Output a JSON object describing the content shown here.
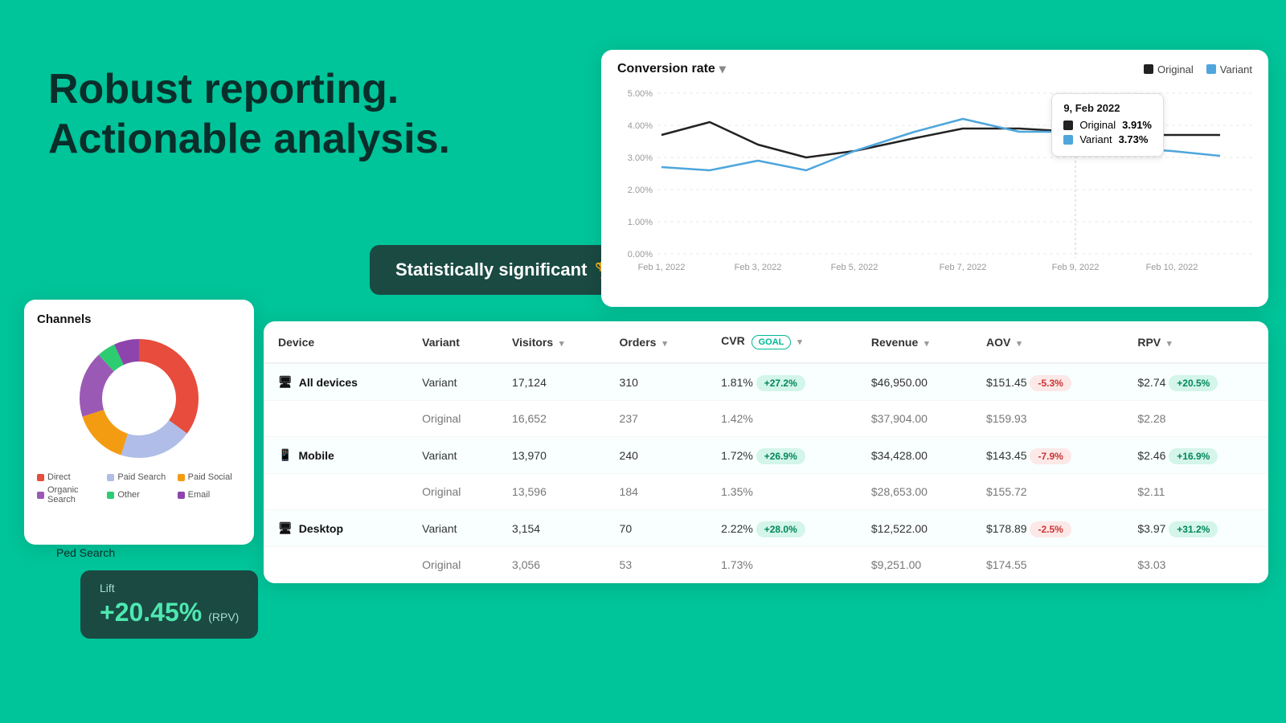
{
  "hero": {
    "line1": "Robust reporting.",
    "line2": "Actionable analysis."
  },
  "stat_sig": {
    "label": "Statistically significant",
    "icon": "🏆"
  },
  "chart": {
    "title": "Conversion rate",
    "dropdown_icon": "▾",
    "legend": [
      {
        "label": "Original",
        "color": "#222"
      },
      {
        "label": "Variant",
        "color": "#4ea6dc"
      }
    ],
    "tooltip": {
      "date": "9, Feb 2022",
      "original_label": "Original",
      "original_value": "3.91%",
      "variant_label": "Variant",
      "variant_value": "3.73%"
    },
    "y_labels": [
      "5.00%",
      "4.00%",
      "3.00%",
      "2.00%",
      "1.00%",
      "0.00%"
    ],
    "x_labels": [
      "Feb 1, 2022",
      "Feb 3, 2022",
      "Feb 5, 2022",
      "Feb 7, 2022",
      "Feb 9, 2022",
      "Feb 10, 2022"
    ]
  },
  "channels": {
    "title": "Channels",
    "legend": [
      {
        "label": "Direct",
        "color": "#e74c3c"
      },
      {
        "label": "Paid Search",
        "color": "#bdc3e8"
      },
      {
        "label": "Paid Social",
        "color": "#f39c12"
      },
      {
        "label": "Organic Search",
        "color": "#9b59b6"
      },
      {
        "label": "Other",
        "color": "#2ecc71"
      },
      {
        "label": "Email",
        "color": "#8e44ad"
      }
    ]
  },
  "lift": {
    "label": "Lift",
    "value": "+20.45%",
    "sub": "(RPV)"
  },
  "ped_search": {
    "label": "Ped Search"
  },
  "table": {
    "columns": [
      "Device",
      "Variant",
      "Visitors",
      "Orders",
      "CVR",
      "Revenue",
      "AOV",
      "RPV"
    ],
    "rows": [
      {
        "device": "All devices",
        "device_icon": "🖥",
        "variant": "Variant",
        "visitors": "17,124",
        "orders": "310",
        "cvr": "1.81%",
        "cvr_badge": "+27.2%",
        "cvr_badge_type": "green",
        "revenue": "$46,950.00",
        "aov": "$151.45",
        "aov_badge": "-5.3%",
        "aov_badge_type": "red",
        "rpv": "$2.74",
        "rpv_badge": "+20.5%",
        "rpv_badge_type": "green",
        "row_type": "variant"
      },
      {
        "device": "",
        "device_icon": "",
        "variant": "Original",
        "visitors": "16,652",
        "orders": "237",
        "cvr": "1.42%",
        "cvr_badge": "",
        "revenue": "$37,904.00",
        "aov": "$159.93",
        "aov_badge": "",
        "rpv": "$2.28",
        "rpv_badge": "",
        "row_type": "original"
      },
      {
        "device": "Mobile",
        "device_icon": "📱",
        "variant": "Variant",
        "visitors": "13,970",
        "orders": "240",
        "cvr": "1.72%",
        "cvr_badge": "+26.9%",
        "cvr_badge_type": "green",
        "revenue": "$34,428.00",
        "aov": "$143.45",
        "aov_badge": "-7.9%",
        "aov_badge_type": "red",
        "rpv": "$2.46",
        "rpv_badge": "+16.9%",
        "rpv_badge_type": "green",
        "row_type": "variant"
      },
      {
        "device": "",
        "device_icon": "",
        "variant": "Original",
        "visitors": "13,596",
        "orders": "184",
        "cvr": "1.35%",
        "cvr_badge": "",
        "revenue": "$28,653.00",
        "aov": "$155.72",
        "aov_badge": "",
        "rpv": "$2.11",
        "rpv_badge": "",
        "row_type": "original"
      },
      {
        "device": "Desktop",
        "device_icon": "🖥",
        "variant": "Variant",
        "visitors": "3,154",
        "orders": "70",
        "cvr": "2.22%",
        "cvr_badge": "+28.0%",
        "cvr_badge_type": "green",
        "revenue": "$12,522.00",
        "aov": "$178.89",
        "aov_badge": "-2.5%",
        "aov_badge_type": "red",
        "rpv": "$3.97",
        "rpv_badge": "+31.2%",
        "rpv_badge_type": "green",
        "row_type": "variant"
      },
      {
        "device": "",
        "device_icon": "",
        "variant": "Original",
        "visitors": "3,056",
        "orders": "53",
        "cvr": "1.73%",
        "cvr_badge": "",
        "revenue": "$9,251.00",
        "aov": "$174.55",
        "aov_badge": "",
        "rpv": "$3.03",
        "rpv_badge": "",
        "row_type": "original"
      }
    ]
  }
}
